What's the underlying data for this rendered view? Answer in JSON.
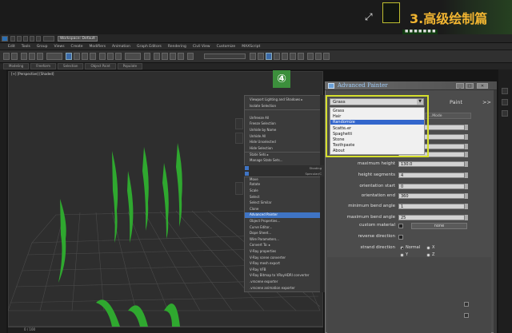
{
  "banner": {
    "title": "3.高级绘制篇",
    "badge": "■ ■ ■ ■ ■ ■ ■ ■",
    "expand_icon": "expand-arrows-icon"
  },
  "titlebar": {
    "workspace": "Workspace: Default"
  },
  "menubar": [
    "Edit",
    "Tools",
    "Group",
    "Views",
    "Create",
    "Modifiers",
    "Animation",
    "Graph Editors",
    "Rendering",
    "Civil View",
    "Customize",
    "MAXScript"
  ],
  "ribbon": [
    "Modeling",
    "Freeform",
    "Selection",
    "Object Paint",
    "Populate"
  ],
  "viewport": {
    "label": "[+] [Perspective] [Shaded]",
    "frame_counter": "0 / 100"
  },
  "step_badge": "④",
  "quad_menu": {
    "items": [
      {
        "label": "Viewport Lighting and Shadows ▸",
        "sep": false,
        "hl": false
      },
      {
        "label": "Isolate Selection",
        "sep": false,
        "hl": false
      },
      {
        "label": "",
        "sep": true,
        "hl": false
      },
      {
        "label": "Unfreeze All",
        "sep": false,
        "hl": false
      },
      {
        "label": "Freeze Selection",
        "sep": false,
        "hl": false
      },
      {
        "label": "Unhide by Name",
        "sep": false,
        "hl": false
      },
      {
        "label": "Unhide All",
        "sep": false,
        "hl": false
      },
      {
        "label": "Hide Unselected",
        "sep": false,
        "hl": false
      },
      {
        "label": "Hide Selection",
        "sep": false,
        "hl": false
      },
      {
        "label": "State Sets ▸",
        "sep": true,
        "hl": false
      },
      {
        "label": "Manage State Sets...",
        "sep": false,
        "hl": false
      },
      {
        "label": "",
        "sep": false,
        "hl": false
      },
      {
        "label": "",
        "sep": false,
        "hl": false
      },
      {
        "label": "Move",
        "sep": true,
        "hl": false
      },
      {
        "label": "Rotate",
        "sep": false,
        "hl": false
      },
      {
        "label": "Scale",
        "sep": false,
        "hl": false
      },
      {
        "label": "Select",
        "sep": false,
        "hl": false
      },
      {
        "label": "Select Similar",
        "sep": false,
        "hl": false
      },
      {
        "label": "Clone",
        "sep": false,
        "hl": false
      },
      {
        "label": "Advanced Painter",
        "sep": false,
        "hl": true
      },
      {
        "label": "Object Properties...",
        "sep": false,
        "hl": false
      },
      {
        "label": "Curve Editor...",
        "sep": false,
        "hl": false
      },
      {
        "label": "Dope Sheet...",
        "sep": false,
        "hl": false
      },
      {
        "label": "Wire Parameters...",
        "sep": false,
        "hl": false
      },
      {
        "label": "Convert To: ▸",
        "sep": false,
        "hl": false
      },
      {
        "label": "V-Ray properties",
        "sep": false,
        "hl": false
      },
      {
        "label": "V-Ray scene converter",
        "sep": false,
        "hl": false
      },
      {
        "label": "V-Ray mesh export",
        "sep": false,
        "hl": false
      },
      {
        "label": "V-Ray VFB",
        "sep": false,
        "hl": false
      },
      {
        "label": "V-Ray Bitmap to VRayHDRI converter",
        "sep": false,
        "hl": false
      },
      {
        "label": ".vrscene exporter",
        "sep": false,
        "hl": false
      },
      {
        "label": ".vrscene animation exporter",
        "sep": false,
        "hl": false
      }
    ],
    "slider1_label": "Shading",
    "slider2_label": "Specular/C"
  },
  "advanced_painter": {
    "title": "Advanced Painter",
    "combo_value": "Grass",
    "paint_label": "Paint",
    "more_label": ">>",
    "tab_label": "...Mode",
    "dropdown_items": [
      "Grass",
      "Hair",
      "Randomize",
      "Scatterer",
      "Spaghetti",
      "Stone",
      "Toothpaste",
      "About"
    ],
    "dropdown_selected": 2,
    "params": [
      {
        "label": "maximum height",
        "value": "130.0"
      },
      {
        "label": "height segments",
        "value": "4"
      },
      {
        "label": "orientation start",
        "value": "0"
      },
      {
        "label": "orientation end",
        "value": "360"
      },
      {
        "label": "minimum bend angle",
        "value": "1"
      },
      {
        "label": "maximum bend angle",
        "value": "25"
      }
    ],
    "custom_material_label": "custom material",
    "custom_material_value": "none",
    "reverse_direction_label": "reverse direction",
    "strand_direction_label": "strand direction",
    "radio_normal": "Normal",
    "radio_x": "X",
    "radio_y": "Y",
    "radio_z": "Z"
  },
  "colors": {
    "accent_yellow": "#d6df2d",
    "highlight_blue": "#3f74c4",
    "banner_orange": "#f2b531",
    "step_green": "#3c8f3c",
    "grass_green": "#2fa82f"
  }
}
